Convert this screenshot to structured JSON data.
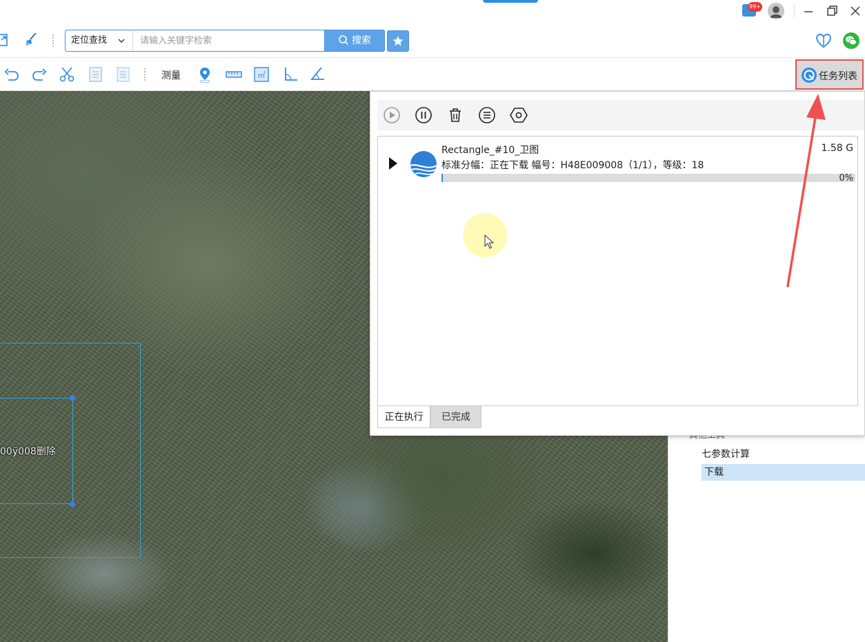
{
  "titlebar": {
    "notification_badge": "99+",
    "accent_color": "#2f8ce6"
  },
  "toolbar1": {
    "search_category": "定位查找",
    "search_placeholder": "请输入关键字检索",
    "search_value": "",
    "search_button": "搜索"
  },
  "toolbar2": {
    "measure_label": "测量",
    "task_list_button": "任务列表"
  },
  "map": {
    "selection_label": "00ÿ008删除"
  },
  "side_panel": {
    "clipped_item": "其他工具",
    "items": [
      "七参数计算",
      "下载"
    ],
    "selected_index": 1
  },
  "task_panel": {
    "tasks": [
      {
        "name": "Rectangle_#10_卫图",
        "size": "1.58 G",
        "status": "标准分幅：正在下载 幅号：H48E009008（1/1），等级：18",
        "progress_text": "0%",
        "progress": 0
      }
    ],
    "tabs": [
      "正在执行",
      "已完成"
    ],
    "active_tab": 0
  },
  "annotation": {
    "arrow_color": "#f05050"
  }
}
